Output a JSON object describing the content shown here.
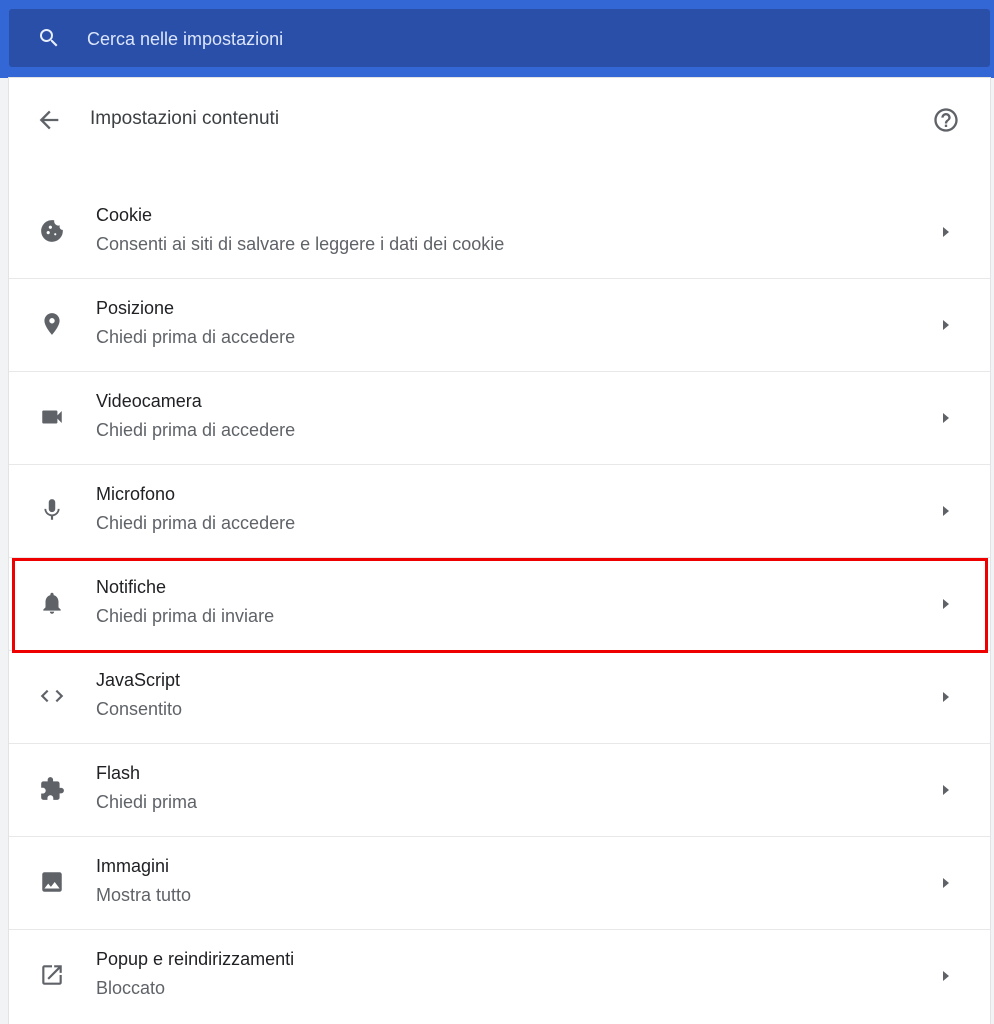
{
  "search": {
    "placeholder": "Cerca nelle impostazioni",
    "value": ""
  },
  "header": {
    "title": "Impostazioni contenuti"
  },
  "colors": {
    "topbar": "#3367d6",
    "searchbox": "#2a4fa8",
    "highlight": "#ee0000"
  },
  "items": [
    {
      "icon": "cookie-icon",
      "title": "Cookie",
      "subtitle": "Consenti ai siti di salvare e leggere i dati dei cookie"
    },
    {
      "icon": "location-pin-icon",
      "title": "Posizione",
      "subtitle": "Chiedi prima di accedere"
    },
    {
      "icon": "videocam-icon",
      "title": "Videocamera",
      "subtitle": "Chiedi prima di accedere"
    },
    {
      "icon": "microphone-icon",
      "title": "Microfono",
      "subtitle": "Chiedi prima di accedere"
    },
    {
      "icon": "bell-icon",
      "title": "Notifiche",
      "subtitle": "Chiedi prima di inviare",
      "highlighted": true
    },
    {
      "icon": "code-icon",
      "title": "JavaScript",
      "subtitle": "Consentito"
    },
    {
      "icon": "puzzle-icon",
      "title": "Flash",
      "subtitle": "Chiedi prima"
    },
    {
      "icon": "image-icon",
      "title": "Immagini",
      "subtitle": "Mostra tutto"
    },
    {
      "icon": "open-in-new-icon",
      "title": "Popup e reindirizzamenti",
      "subtitle": "Bloccato"
    }
  ]
}
